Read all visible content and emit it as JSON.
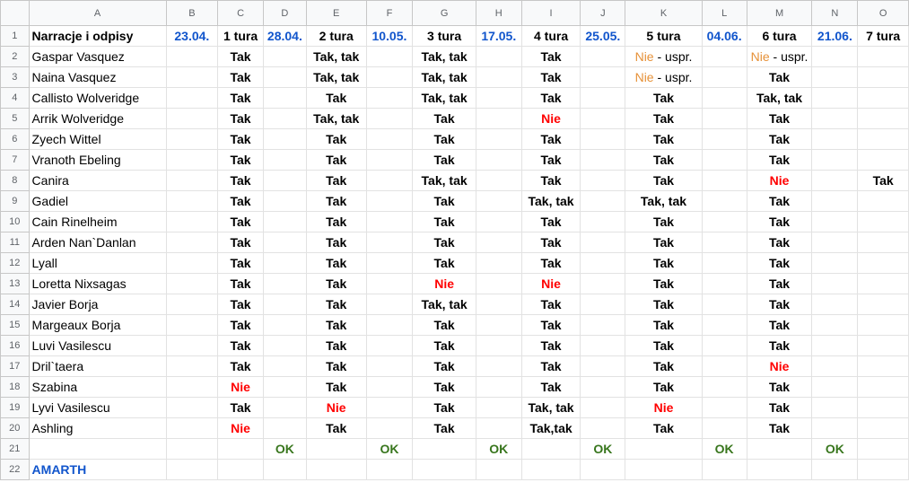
{
  "columns": [
    "A",
    "B",
    "C",
    "D",
    "E",
    "F",
    "G",
    "H",
    "I",
    "J",
    "K",
    "L",
    "M",
    "N",
    "O"
  ],
  "header_row": [
    "Narracje i odpisy",
    "23.04.",
    "1 tura",
    "28.04.",
    "2 tura",
    "10.05.",
    "3 tura",
    "17.05.",
    "4 tura",
    "25.05.",
    "5 tura",
    "04.06.",
    "6 tura",
    "21.06.",
    "7 tura"
  ],
  "rows": [
    {
      "name": "Gaspar Vasquez",
      "cells": [
        "",
        "Tak",
        "",
        "Tak, tak",
        "",
        "Tak, tak",
        "",
        "Tak",
        "",
        "Nie|- uspr.",
        "",
        "Nie|- uspr.",
        "",
        ""
      ]
    },
    {
      "name": "Naina Vasquez",
      "cells": [
        "",
        "Tak",
        "",
        "Tak, tak",
        "",
        "Tak, tak",
        "",
        "Tak",
        "",
        "Nie|- uspr.",
        "",
        "Tak",
        "",
        ""
      ]
    },
    {
      "name": "Callisto Wolveridge",
      "cells": [
        "",
        "Tak",
        "",
        "Tak",
        "",
        "Tak, tak",
        "",
        "Tak",
        "",
        "Tak",
        "",
        "Tak, tak",
        "",
        ""
      ]
    },
    {
      "name": "Arrik Wolveridge",
      "cells": [
        "",
        "Tak",
        "",
        "Tak, tak",
        "",
        "Tak",
        "",
        "Nie",
        "",
        "Tak",
        "",
        "Tak",
        "",
        ""
      ]
    },
    {
      "name": "Zyech Wittel",
      "cells": [
        "",
        "Tak",
        "",
        "Tak",
        "",
        "Tak",
        "",
        "Tak",
        "",
        "Tak",
        "",
        "Tak",
        "",
        ""
      ]
    },
    {
      "name": "Vranoth Ebeling",
      "cells": [
        "",
        "Tak",
        "",
        "Tak",
        "",
        "Tak",
        "",
        "Tak",
        "",
        "Tak",
        "",
        "Tak",
        "",
        ""
      ]
    },
    {
      "name": "Canira",
      "cells": [
        "",
        "Tak",
        "",
        "Tak",
        "",
        "Tak, tak",
        "",
        "Tak",
        "",
        "Tak",
        "",
        "Nie",
        "",
        "Tak"
      ]
    },
    {
      "name": "Gadiel",
      "cells": [
        "",
        "Tak",
        "",
        "Tak",
        "",
        "Tak",
        "",
        "Tak, tak",
        "",
        "Tak, tak",
        "",
        "Tak",
        "",
        ""
      ]
    },
    {
      "name": "Cain Rinelheim",
      "cells": [
        "",
        "Tak",
        "",
        "Tak",
        "",
        "Tak",
        "",
        "Tak",
        "",
        "Tak",
        "",
        "Tak",
        "",
        ""
      ]
    },
    {
      "name": "Arden Nan`Danlan",
      "cells": [
        "",
        "Tak",
        "",
        "Tak",
        "",
        "Tak",
        "",
        "Tak",
        "",
        "Tak",
        "",
        "Tak",
        "",
        ""
      ]
    },
    {
      "name": "Lyall",
      "cells": [
        "",
        "Tak",
        "",
        "Tak",
        "",
        "Tak",
        "",
        "Tak",
        "",
        "Tak",
        "",
        "Tak",
        "",
        ""
      ]
    },
    {
      "name": "Loretta Nixsagas",
      "cells": [
        "",
        "Tak",
        "",
        "Tak",
        "",
        "Nie",
        "",
        "Nie",
        "",
        "Tak",
        "",
        "Tak",
        "",
        ""
      ]
    },
    {
      "name": "Javier Borja",
      "cells": [
        "",
        "Tak",
        "",
        "Tak",
        "",
        "Tak, tak",
        "",
        "Tak",
        "",
        "Tak",
        "",
        "Tak",
        "",
        ""
      ]
    },
    {
      "name": "Margeaux Borja",
      "cells": [
        "",
        "Tak",
        "",
        "Tak",
        "",
        "Tak",
        "",
        "Tak",
        "",
        "Tak",
        "",
        "Tak",
        "",
        ""
      ]
    },
    {
      "name": "Luvi Vasilescu",
      "cells": [
        "",
        "Tak",
        "",
        "Tak",
        "",
        "Tak",
        "",
        "Tak",
        "",
        "Tak",
        "",
        "Tak",
        "",
        ""
      ]
    },
    {
      "name": "Dril`taera",
      "cells": [
        "",
        "Tak",
        "",
        "Tak",
        "",
        "Tak",
        "",
        "Tak",
        "",
        "Tak",
        "",
        "Nie",
        "",
        ""
      ]
    },
    {
      "name": "Szabina",
      "cells": [
        "",
        "Nie",
        "",
        "Tak",
        "",
        "Tak",
        "",
        "Tak",
        "",
        "Tak",
        "",
        "Tak",
        "",
        ""
      ]
    },
    {
      "name": "Lyvi Vasilescu",
      "cells": [
        "",
        "Tak",
        "",
        "Nie",
        "",
        "Tak",
        "",
        "Tak, tak",
        "",
        "Nie",
        "",
        "Tak",
        "",
        ""
      ]
    },
    {
      "name": "Ashling",
      "cells": [
        "",
        "Nie",
        "",
        "Tak",
        "",
        "Tak",
        "",
        "Tak,tak",
        "",
        "Tak",
        "",
        "Tak",
        "",
        ""
      ]
    }
  ],
  "row21": [
    "",
    "",
    "",
    "OK",
    "",
    "OK",
    "",
    "OK",
    "",
    "OK",
    "",
    "OK",
    "",
    "OK",
    ""
  ],
  "row22_label": "AMARTH",
  "row_numbers": [
    "1",
    "2",
    "3",
    "4",
    "5",
    "6",
    "7",
    "8",
    "9",
    "10",
    "11",
    "12",
    "13",
    "14",
    "15",
    "16",
    "17",
    "18",
    "19",
    "20",
    "21",
    "22"
  ],
  "colors": {
    "blue": "#1155cc",
    "red": "#ff0000",
    "orange": "#e69138",
    "green": "#38761d",
    "header_bg": "#f8f9fa",
    "grid": "#e2e2e2"
  }
}
